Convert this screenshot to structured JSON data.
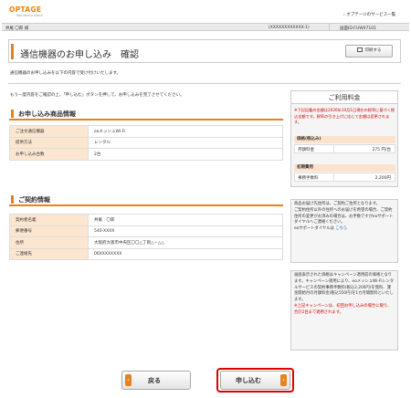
{
  "header": {
    "logo": "OPTAGE",
    "logo_sub": "Wonderful world",
    "service_link": "› オプテージのサービス一覧"
  },
  "info_bar": {
    "user": "井尾 〇郎 様",
    "number": "(XXXXXXXXXXXX-1)",
    "screen_id": "画面ID:FUW07101"
  },
  "page": {
    "title": "通信機器のお申し込み　確認",
    "print_label": "印刷する",
    "desc1": "通信機器のお申し込みを以下の内容で受け付けいたします。",
    "desc2": "もう一度内容をご確認の上、「申し込む」ボタンを押して、お申し込みを完了させてください。"
  },
  "order": {
    "heading": "お申し込み商品情報",
    "rows": [
      {
        "label": "ご注文通信機器",
        "value": "eoメッシュWi-Fi"
      },
      {
        "label": "提供方法",
        "value": "レンタル"
      },
      {
        "label": "お申し込み台数",
        "value": "2台"
      }
    ]
  },
  "contract": {
    "heading": "ご契約情報",
    "rows": [
      {
        "label": "契約者名義",
        "value": "井尾　〇郎"
      },
      {
        "label": "郵便番号",
        "value": "540-XXXX"
      },
      {
        "label": "住所",
        "value": "大阪府大阪市中央区〇〇△丁目△－△△"
      },
      {
        "label": "ご連絡先",
        "value": "06XXXXXXXX"
      }
    ]
  },
  "sidebar": {
    "title": "ご利用料金",
    "note": "※下記記載の金額は2026年10月1日現在の税率に基づく税込金額です。税率の引き上げに応じて金額は変更されます。",
    "price_head": "価格(税込み)",
    "monthly_label": "月額料金",
    "monthly_value": "275 円/台",
    "initial_head": "初期費用",
    "fee_label": "事務手数料",
    "fee_value": "2,200円",
    "box2_line1": "商品お届け先住所は、ご契約ご住所となります。",
    "box2_line2": "ご契約住所以外の住所へのお届けを希望の場合、ご契約住所の変更がお済みの場合は、お手数ですがeoサポートダイヤルへご連絡ください。",
    "box2_link_pre": "eoサポートダイヤルは ",
    "box2_link": "こちら",
    "box3_text": "画面表示された価格はキャンペーン適用前の価格となります。キャンペーン適用により、eoメッシュWi-Fiレンタルサービスの契約事務手数料(税込2,200円)を無料、課金開始月の月額料金(税込550円)を1カ月間無料といたします。",
    "box3_note": "※上記キャンペーンは、初回お申し込みの場合に限り、合計2台まで適用されます。"
  },
  "buttons": {
    "back": "戻る",
    "submit": "申し込む"
  },
  "colors": {
    "accent": "#e8821e",
    "table_header": "#fde6cf",
    "highlight": "#e00000"
  }
}
